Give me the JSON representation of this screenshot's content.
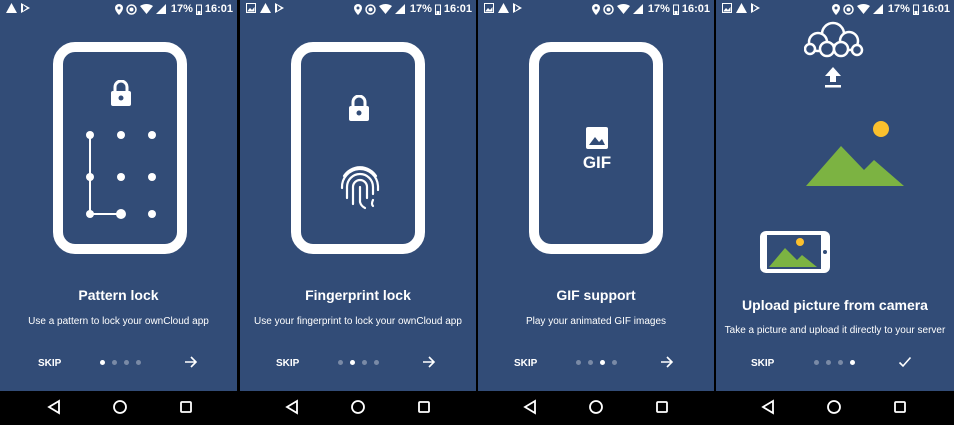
{
  "status_bar": {
    "battery": "17%",
    "time": "16:01"
  },
  "screens": [
    {
      "title": "Pattern lock",
      "subtitle": "Use a pattern to lock your ownCloud app",
      "skip": "SKIP",
      "active_dot": 1,
      "next_icon": "arrow-right-icon"
    },
    {
      "title": "Fingerprint lock",
      "subtitle": "Use your fingerprint to lock your ownCloud app",
      "skip": "SKIP",
      "active_dot": 2,
      "next_icon": "arrow-right-icon"
    },
    {
      "title": "GIF support",
      "subtitle": "Play your animated GIF images",
      "skip": "SKIP",
      "active_dot": 3,
      "next_icon": "arrow-right-icon",
      "gif_label": "GIF"
    },
    {
      "title": "Upload picture from camera",
      "subtitle": "Take a picture and upload it directly to your server",
      "skip": "SKIP",
      "active_dot": 4,
      "next_icon": "checkmark-icon"
    }
  ],
  "colors": {
    "background": "#324c77",
    "mountain": "#7cb342",
    "sun": "#fbc02d"
  }
}
